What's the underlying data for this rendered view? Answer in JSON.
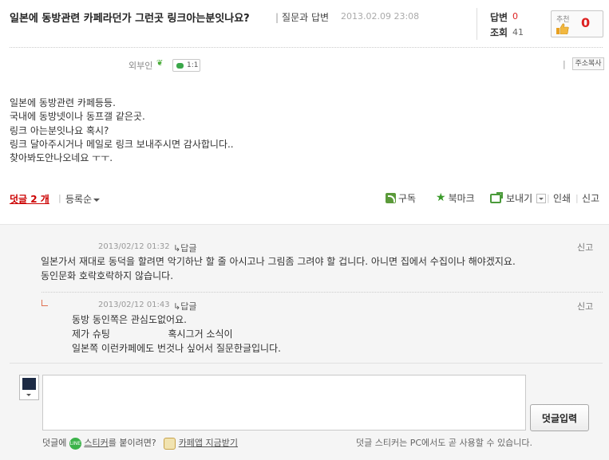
{
  "post": {
    "title": "일본에 동방관련 카페라던가 그런곳 링크아는분잇나요?",
    "category": "질문과 답변",
    "category_sep": "|",
    "date": "2013.02.09 23:08",
    "answers_label": "답변",
    "answers_count": "0",
    "views_label": "조회",
    "views_count": "41",
    "recommend_label": "추천",
    "recommend_count": "0",
    "author": "외부인",
    "chat_count": "1:1",
    "address_sep": "|",
    "address_copy": "주소복사",
    "content": [
      "일본에 동방관련 카페등등.",
      "국내에 동방넷이나 동프갤 같은곳.",
      "링크 아는분잇나요 혹시?",
      "링크 달아주시거나 메일로 링크 보내주시면 감사합니다..",
      "찾아봐도안나오네요 ㅜㅜ."
    ]
  },
  "comments_bar": {
    "count_label": "덧글 2 개",
    "sep": "|",
    "sort_label": "등록순",
    "subscribe": "구독",
    "bookmark": "북마크",
    "send": "보내기",
    "print": "인쇄",
    "report": "신고",
    "sep2": "|"
  },
  "comments": [
    {
      "date": "2013/02/12 01:32",
      "reply": "↳답글",
      "report": "신고",
      "lines": [
        "일본가서 재대로 동덕을 할려면 악기하난 할 줄 아시고나 그림좀 그려야 할 겁니다. 아니면 집에서 수집이나 해야겠지요.",
        "동인문화 호락호락하지 않습니다."
      ]
    },
    {
      "date": "2013/02/12 01:43",
      "reply": "↳답글",
      "report": "신고",
      "lines": [
        "동방 동인쪽은 관심도없어요.",
        "제가 슈팅                   혹시그거 소식이",
        "일본쪽 이런카페에도 번것나 싶어서 질문한글입니다."
      ]
    }
  ],
  "comment_form": {
    "submit_label": "덧글입력",
    "sticker_prefix": "덧글에",
    "line_icon_text": "LINE",
    "sticker_link": "스티커",
    "sticker_suffix": "를 붙이려면?",
    "cafe_app_link": "카페앱 지금받기",
    "pc_notice": "덧글 스티커는 PC에서도 곧 사용할 수 있습니다."
  }
}
